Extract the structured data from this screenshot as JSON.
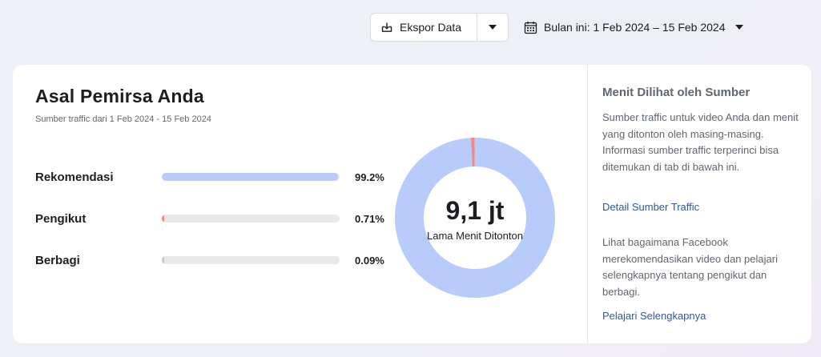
{
  "toolbar": {
    "export_label": "Ekspor Data",
    "date_range_label": "Bulan ini: 1 Feb 2024 – 15 Feb 2024"
  },
  "audience": {
    "title": "Asal Pemirsa Anda",
    "subtitle": "Sumber traffic dari 1 Feb 2024 - 15 Feb 2024",
    "sources": [
      {
        "name": "Rekomendasi",
        "percent_label": "99.2%",
        "percent": 99.2,
        "color": "#b7ccfb"
      },
      {
        "name": "Pengikut",
        "percent_label": "0.71%",
        "percent": 0.71,
        "color": "#f2878d"
      },
      {
        "name": "Berbagi",
        "percent_label": "0.09%",
        "percent": 0.09,
        "color": "#c5c7ca"
      }
    ],
    "total_value": "9,1 jt",
    "total_caption": "Lama Menit Ditonton"
  },
  "sidebar": {
    "title": "Menit Dilihat oleh Sumber",
    "description": "Sumber traffic untuk video Anda dan menit yang ditonton oleh masing-masing. Informasi sumber traffic terperinci bisa ditemukan di tab di bawah ini.",
    "detail_link": "Detail Sumber Traffic",
    "recommend_text": "Lihat bagaimana Facebook merekomendasikan video dan pelajari selengkapnya tentang pengikut dan berbagi.",
    "learn_more_link": "Pelajari Selengkapnya"
  },
  "chart_data": {
    "type": "pie",
    "categories": [
      "Rekomendasi",
      "Pengikut",
      "Berbagi"
    ],
    "values": [
      99.2,
      0.71,
      0.09
    ],
    "colors": [
      "#b7ccfb",
      "#f2878d",
      "#c5c7ca"
    ],
    "center_value": "9,1 jt",
    "center_caption": "Lama Menit Ditonton"
  }
}
